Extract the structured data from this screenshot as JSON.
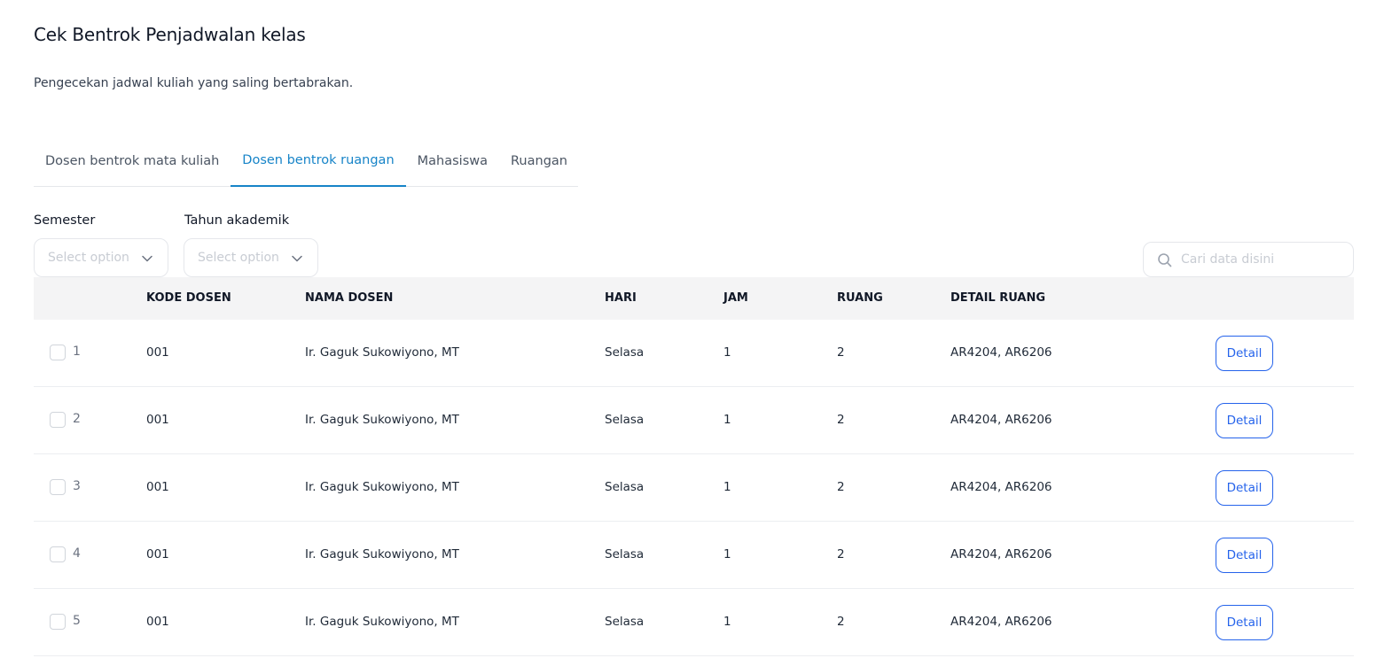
{
  "header": {
    "title": "Cek Bentrok Penjadwalan kelas",
    "subtitle": "Pengecekan jadwal kuliah yang saling bertabrakan."
  },
  "tabs": [
    {
      "label": "Dosen bentrok mata kuliah",
      "active": false
    },
    {
      "label": "Dosen bentrok ruangan",
      "active": true
    },
    {
      "label": "Mahasiswa",
      "active": false
    },
    {
      "label": "Ruangan",
      "active": false
    }
  ],
  "filters": {
    "semester": {
      "label": "Semester",
      "placeholder": "Select option"
    },
    "tahun": {
      "label": "Tahun akademik",
      "placeholder": "Select option"
    }
  },
  "search": {
    "placeholder": "Cari data disini"
  },
  "table": {
    "columns": [
      "KODE DOSEN",
      "NAMA DOSEN",
      "HARI",
      "JAM",
      "RUANG",
      "DETAIL RUANG"
    ],
    "action_label": "Detail",
    "rows": [
      {
        "no": "1",
        "kode": "001",
        "nama": "Ir. Gaguk Sukowiyono, MT",
        "hari": "Selasa",
        "jam": "1",
        "ruang": "2",
        "detail_ruang": "AR4204, AR6206"
      },
      {
        "no": "2",
        "kode": "001",
        "nama": "Ir. Gaguk Sukowiyono, MT",
        "hari": "Selasa",
        "jam": "1",
        "ruang": "2",
        "detail_ruang": "AR4204, AR6206"
      },
      {
        "no": "3",
        "kode": "001",
        "nama": "Ir. Gaguk Sukowiyono, MT",
        "hari": "Selasa",
        "jam": "1",
        "ruang": "2",
        "detail_ruang": "AR4204, AR6206"
      },
      {
        "no": "4",
        "kode": "001",
        "nama": "Ir. Gaguk Sukowiyono, MT",
        "hari": "Selasa",
        "jam": "1",
        "ruang": "2",
        "detail_ruang": "AR4204, AR6206"
      },
      {
        "no": "5",
        "kode": "001",
        "nama": "Ir. Gaguk Sukowiyono, MT",
        "hari": "Selasa",
        "jam": "1",
        "ruang": "2",
        "detail_ruang": "AR4204, AR6206"
      }
    ]
  },
  "colors": {
    "accent": "#1784c8",
    "button": "#2563eb",
    "header_bg": "#f4f4f5"
  }
}
